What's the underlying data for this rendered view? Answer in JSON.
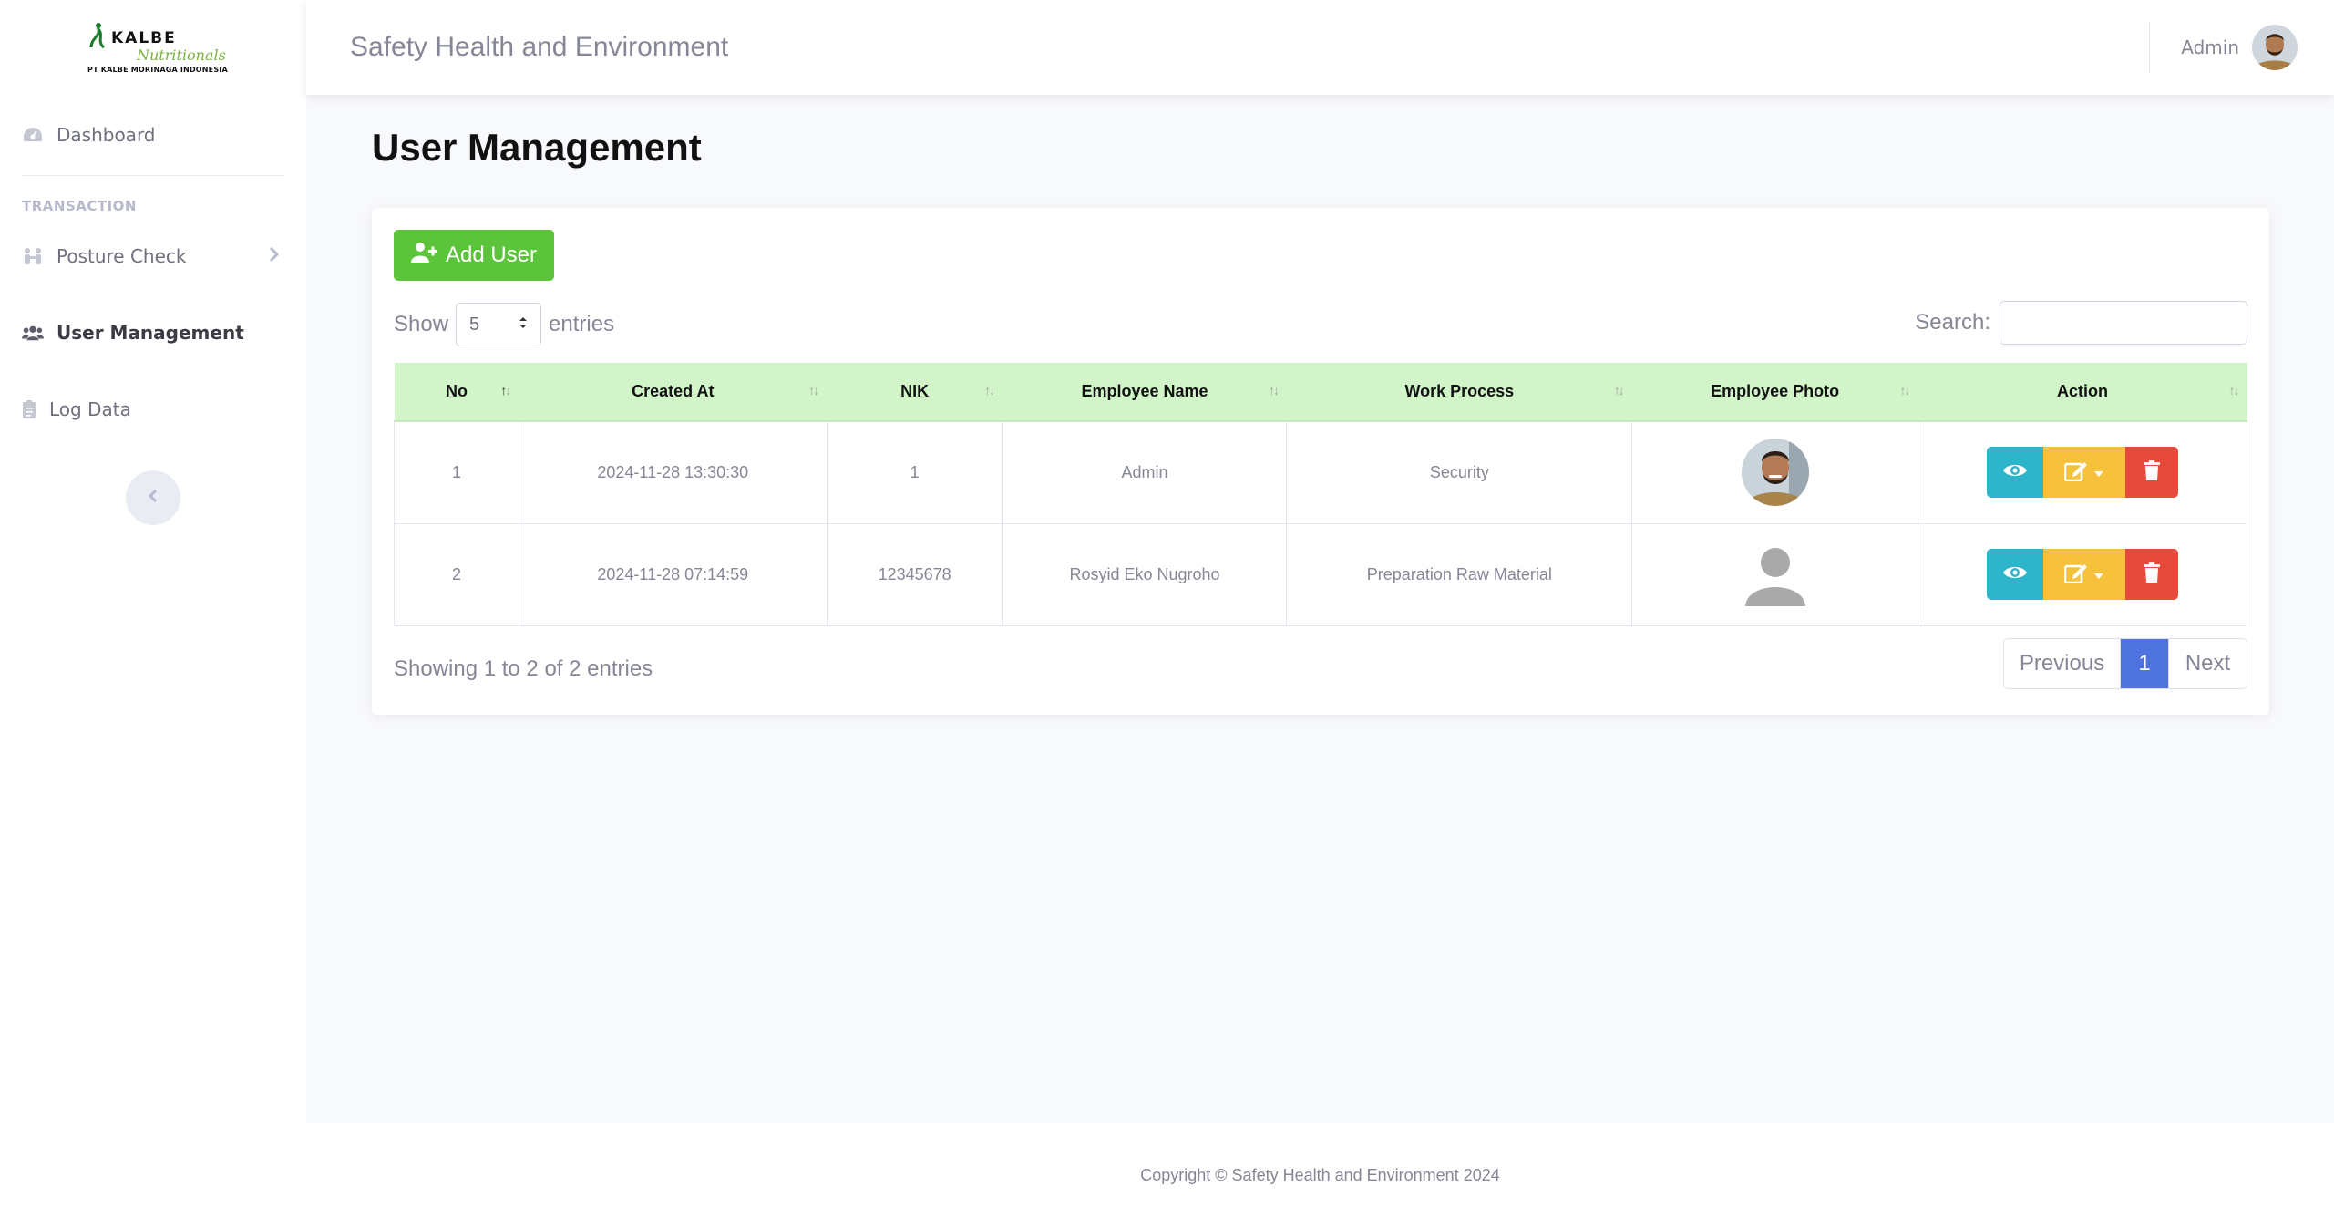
{
  "brand": {
    "name": "KALBE",
    "sub": "Nutritionals",
    "company": "PT KALBE MORINAGA INDONESIA"
  },
  "sidebar": {
    "items": [
      {
        "label": "Dashboard",
        "icon": "dashboard-icon"
      },
      {
        "label": "Posture Check",
        "icon": "people-icon"
      },
      {
        "label": "User Management",
        "icon": "users-icon",
        "active": true
      },
      {
        "label": "Log Data",
        "icon": "clipboard-icon"
      }
    ],
    "heading": "TRANSACTION"
  },
  "topbar": {
    "title": "Safety Health and Environment",
    "user": "Admin"
  },
  "page": {
    "title": "User Management"
  },
  "toolbar": {
    "add_label": "Add User",
    "show_label": "Show",
    "entries_label": "entries",
    "length_value": "5",
    "search_label": "Search:",
    "search_value": ""
  },
  "table": {
    "columns": [
      "No",
      "Created At",
      "NIK",
      "Employee Name",
      "Work Process",
      "Employee Photo",
      "Action"
    ],
    "rows": [
      {
        "no": "1",
        "created_at": "2024-11-28 13:30:30",
        "nik": "1",
        "name": "Admin",
        "process": "Security",
        "photo": "person-photo"
      },
      {
        "no": "2",
        "created_at": "2024-11-28 07:14:59",
        "nik": "12345678",
        "name": "Rosyid Eko Nugroho",
        "process": "Preparation Raw Material",
        "photo": "default-avatar"
      }
    ]
  },
  "pagination": {
    "info": "Showing 1 to 2 of 2 entries",
    "previous": "Previous",
    "current": "1",
    "next": "Next"
  },
  "footer": {
    "text": "Copyright © Safety Health and Environment 2024"
  },
  "colors": {
    "add_button": "#5cc43a",
    "header_bg": "#d2f4c9",
    "view": "#2fb5cb",
    "edit": "#f6c23e",
    "delete": "#e74a3b",
    "page_active": "#4e73df"
  }
}
